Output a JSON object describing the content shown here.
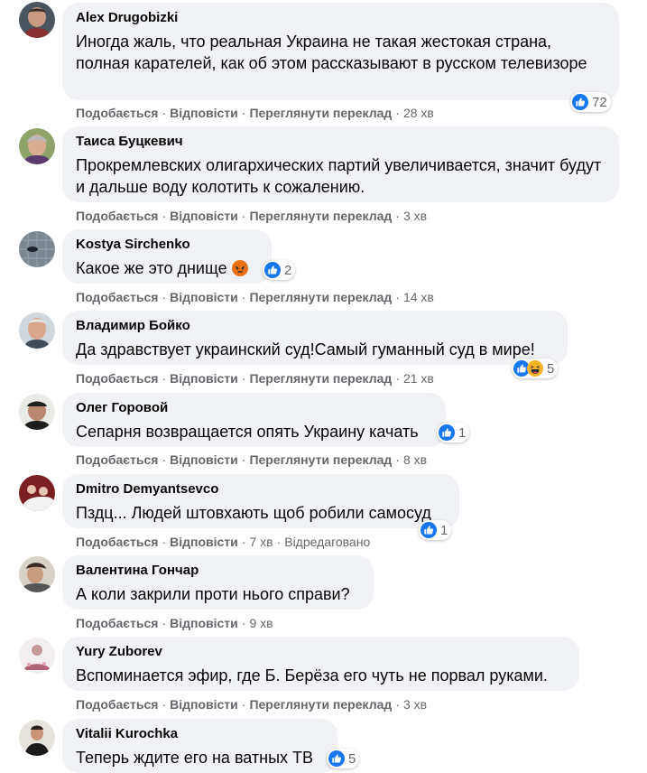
{
  "colors": {
    "bubble": "#f0f2f5",
    "like_blue": "#1877f2",
    "meta_text": "#65676b",
    "angry": "#e9710f",
    "haha": "#f7b125"
  },
  "actions": {
    "like": "Подобається",
    "reply": "Відповісти",
    "translate": "Переглянути переклад",
    "edited": "Відредаговано"
  },
  "comments": [
    {
      "author": "Alex Drugobizki",
      "text": "Иногда жаль, что реальная Украина не такая жестокая страна, полная карателей, как об этом рассказывают в русском телевизоре",
      "reactions": [
        "like-icon"
      ],
      "count": "72",
      "time": "28 хв"
    },
    {
      "author": "Таиса Буцкевич",
      "text": "Прокремлевских олигархических партий увеличивается, значит будут и дальше воду колотить к сожалению.",
      "time": "3 хв"
    },
    {
      "author": "Kostya Sirchenko",
      "text": "Какое же это днище",
      "reactions": [
        "like-icon"
      ],
      "count": "2",
      "time": "14 хв"
    },
    {
      "author": "Владимир Бойко",
      "text": "Да здравствует украинский суд!Самый гуманный суд в мире!",
      "reactions": [
        "like-icon",
        "haha-icon"
      ],
      "count": "5",
      "time": "21 хв"
    },
    {
      "author": "Олег Горовой",
      "text": "Сепарня возвращается опять Украину качать",
      "reactions": [
        "like-icon"
      ],
      "count": "1",
      "time": "8 хв"
    },
    {
      "author": "Dmitro Demyantsevco",
      "text": "Пздц... Людей штовхають щоб робили самосуд",
      "reactions": [
        "like-icon"
      ],
      "count": "1",
      "time": "7 хв"
    },
    {
      "author": "Валентина Гончар",
      "text": "А коли закрили проти нього справи?",
      "time": "9 хв"
    },
    {
      "author": "Yury Zuborev",
      "text": "Вспоминается эфир, где Б. Берёза его чуть не порвал руками.",
      "time": "3 хв"
    },
    {
      "author": "Vitalii Kurochka",
      "text": "Теперь ждите его на ватных ТВ",
      "reactions": [
        "like-icon"
      ],
      "count": "5"
    }
  ]
}
